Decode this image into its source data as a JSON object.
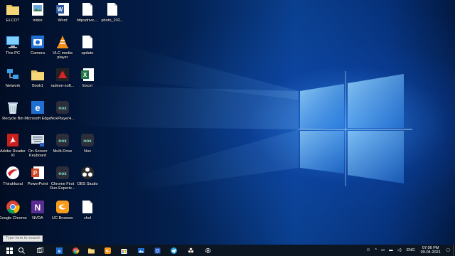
{
  "desktop": {
    "icons": [
      {
        "label": "ELCOT",
        "icon": "folder-icon"
      },
      {
        "label": "index",
        "icon": "image-file-icon"
      },
      {
        "label": "Word",
        "icon": "word-icon"
      },
      {
        "label": "httpsdrive....",
        "icon": "document-icon"
      },
      {
        "label": "photo_202...",
        "icon": "document-icon"
      },
      {
        "label": "This PC",
        "icon": "this-pc-icon"
      },
      {
        "label": "Camera",
        "icon": "camera-icon"
      },
      {
        "label": "VLC media player",
        "icon": "vlc-icon"
      },
      {
        "label": "update",
        "icon": "document-icon"
      },
      {
        "label": "Network",
        "icon": "network-icon"
      },
      {
        "label": "Book1",
        "icon": "folder-icon"
      },
      {
        "label": "radeon-soft...",
        "icon": "radeon-icon"
      },
      {
        "label": "Excel",
        "icon": "excel-icon"
      },
      {
        "label": "Recycle Bin",
        "icon": "recycle-bin-icon"
      },
      {
        "label": "Microsoft Edge",
        "icon": "edge-icon"
      },
      {
        "label": "NoxPlayer4...",
        "icon": "nox-icon"
      },
      {
        "label": "Adobe Reader XI",
        "icon": "adobe-reader-icon"
      },
      {
        "label": "On-Screen Keyboard",
        "icon": "keyboard-icon"
      },
      {
        "label": "Multi-Drive",
        "icon": "nox-icon"
      },
      {
        "label": "Nox",
        "icon": "nox-icon"
      },
      {
        "label": "Thirukkural",
        "icon": "thirukkural-icon"
      },
      {
        "label": "PowerPoint",
        "icon": "powerpoint-icon"
      },
      {
        "label": "Chrome First Run Experie...",
        "icon": "nox-icon"
      },
      {
        "label": "OBS Studio",
        "icon": "obs-icon"
      },
      {
        "label": "Google Chrome",
        "icon": "chrome-icon"
      },
      {
        "label": "NVDA",
        "icon": "nvda-icon"
      },
      {
        "label": "UC Browser",
        "icon": "uc-browser-icon"
      },
      {
        "label": "chsl",
        "icon": "document-icon"
      }
    ]
  },
  "taskbar": {
    "search_placeholder": "Type here to search",
    "pinned": [
      "start-icon",
      "search-icon",
      "task-view-icon",
      "edge-icon",
      "chrome-icon",
      "file-explorer-icon",
      "uc-browser-icon",
      "store-icon",
      "photos-icon",
      "settings-sync-icon",
      "telegram-icon",
      "obs-icon",
      "settings-icon"
    ],
    "tray": {
      "language": "ENG",
      "time": "07:06 PM",
      "date": "09-04-2021"
    }
  },
  "colors": {
    "taskbar": "#0c1623",
    "wallpaper_glow": "#3c96ff"
  }
}
